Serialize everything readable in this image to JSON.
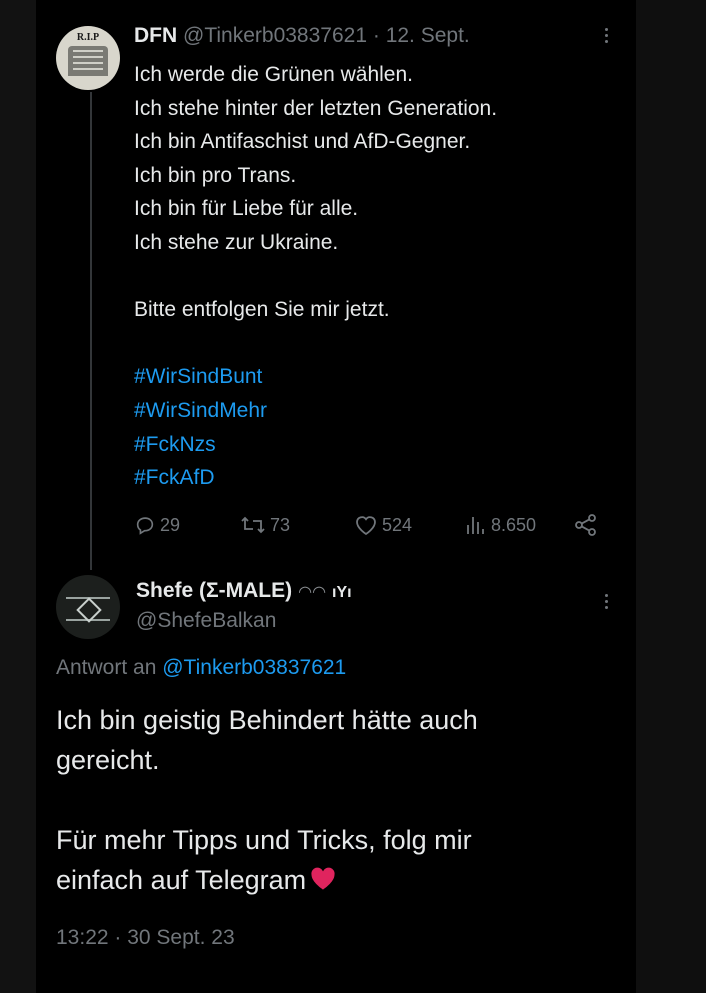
{
  "tweet1": {
    "avatar_text": "R.I.P",
    "name": "DFN",
    "handle": "@Tinkerb03837621",
    "separator": "·",
    "date": "12. Sept.",
    "lines": [
      "Ich werde die Grünen wählen.",
      "Ich stehe hinter der letzten Generation.",
      "Ich bin Antifaschist und AfD-Gegner.",
      "Ich bin pro Trans.",
      "Ich bin für Liebe für alle.",
      "Ich stehe zur Ukraine."
    ],
    "closing": "Bitte entfolgen Sie mir jetzt.",
    "hashtags": [
      "#WirSindBunt",
      "#WirSindMehr",
      "#FckNzs",
      "#FckAfD"
    ],
    "stats": {
      "replies": "29",
      "retweets": "73",
      "likes": "524",
      "views": "8.650"
    },
    "icons": [
      "reply-icon",
      "retweet-icon",
      "like-icon",
      "views-icon",
      "share-icon"
    ]
  },
  "tweet2": {
    "name": "Shefe (Σ-MALE)",
    "name_suffix": "◠◠",
    "flag": "ıYı",
    "handle": "@ShefeBalkan",
    "reply_prefix": "Antwort an",
    "reply_mention": "@Tinkerb03837621",
    "lines1": [
      "Ich bin geistig Behindert hätte auch",
      "gereicht."
    ],
    "lines2": [
      "Für mehr Tipps und Tricks, folg mir",
      "einfach auf Telegram"
    ],
    "emoji": "red-heart",
    "timestamp": "13:22 · 30 Sept. 23"
  },
  "colors": {
    "background": "#000000",
    "text": "#e7e9ea",
    "muted": "#71767b",
    "link": "#1d9bf0",
    "heart": "#e0245e"
  }
}
